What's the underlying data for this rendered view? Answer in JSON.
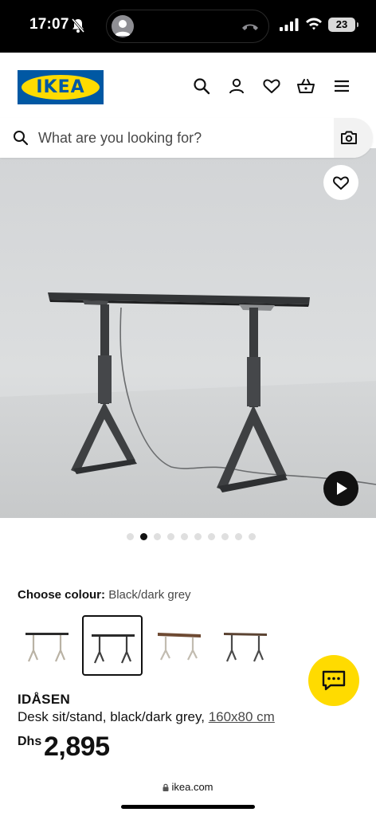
{
  "status_bar": {
    "time": "17:07",
    "battery": "23"
  },
  "header": {
    "logo_text": "IKEA",
    "icons": [
      "search-icon",
      "user-icon",
      "heart-icon",
      "basket-icon",
      "menu-icon"
    ]
  },
  "search": {
    "placeholder": "What are you looking for?"
  },
  "gallery": {
    "image_count": 10,
    "active_index": 1
  },
  "colour": {
    "label": "Choose colour:",
    "value": "Black/dark grey",
    "options": [
      "Black/dark grey (beige frame)",
      "Black/dark grey",
      "Brown (beige frame)",
      "Brown (dark frame)"
    ],
    "selected_index": 1
  },
  "product": {
    "name": "IDÅSEN",
    "description": "Desk sit/stand, black/dark grey,",
    "size": "160x80 cm",
    "currency": "Dhs",
    "price": "2,895"
  },
  "browser": {
    "url": "ikea.com"
  },
  "colors": {
    "ikea_blue": "#0058a3",
    "ikea_yellow": "#ffdb00"
  }
}
